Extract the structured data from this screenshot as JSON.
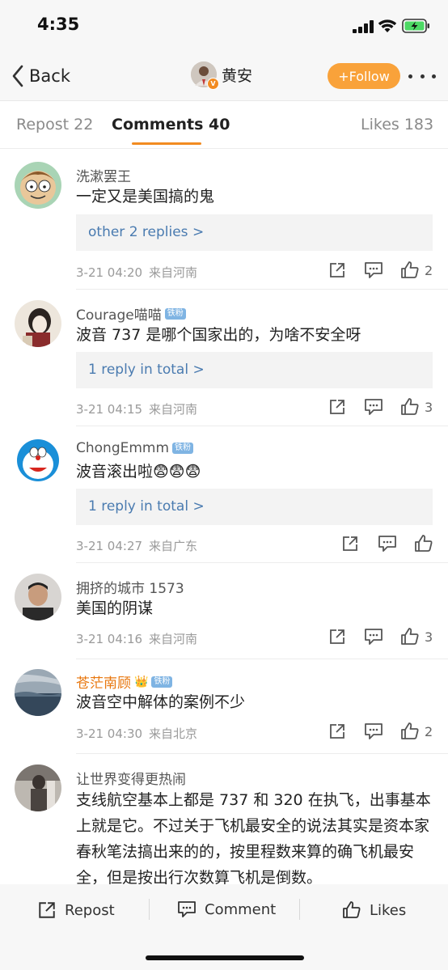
{
  "status_bar": {
    "time": "4:35"
  },
  "nav": {
    "back_label": "Back",
    "user_name": "黄安",
    "follow_label": "Follow",
    "follow_plus": "+"
  },
  "tabs": [
    {
      "label": "Repost 22"
    },
    {
      "label": "Comments 40"
    },
    {
      "label": "Likes 183"
    }
  ],
  "comments": [
    {
      "user": "洗漱罢王",
      "badge": "",
      "text": "一定又是美国搞的鬼",
      "replies": "other 2 replies >",
      "time": "3-21 04:20",
      "source": "来自河南",
      "likes": "2"
    },
    {
      "user": "Courage喵喵",
      "badge": "铁粉",
      "text": "波音 737 是哪个国家出的，为啥不安全呀",
      "replies": "1 reply in total >",
      "time": "3-21 04:15",
      "source": "来自河南",
      "likes": "3"
    },
    {
      "user": "ChongEmmm",
      "badge": "铁粉",
      "text": "波音滚出啦😨😨😨",
      "replies": "1 reply in total >",
      "time": "3-21 04:27",
      "source": "来自广东",
      "likes": ""
    },
    {
      "user": "拥挤的城市 1573",
      "badge": "",
      "text": "美国的阴谋",
      "replies": "",
      "time": "3-21 04:16",
      "source": "来自河南",
      "likes": "3"
    },
    {
      "user": "苍茫南顾",
      "badge": "铁粉",
      "text": "波音空中解体的案例不少",
      "replies": "",
      "time": "3-21 04:30",
      "source": "来自北京",
      "likes": "2"
    },
    {
      "user": "让世界变得更热闹",
      "badge": "",
      "text": "支线航空基本上都是 737 和 320 在执飞，出事基本上就是它。不过关于飞机最安全的说法其实是资本家春秋笔法搞出来的的，按里程数来算的确飞机最安全，但是按出行次数算飞机是倒数。",
      "replies": "",
      "time": "",
      "source": "",
      "likes": ""
    }
  ],
  "bottom_bar": {
    "repost_label": "Repost",
    "comment_label": "Comment",
    "likes_label": "Likes"
  },
  "colors": {
    "accent": "#f28b21",
    "follow_bg": "#f9a23a",
    "link_blue": "#4a7bb0",
    "badge_blue": "#7fb4e3"
  }
}
